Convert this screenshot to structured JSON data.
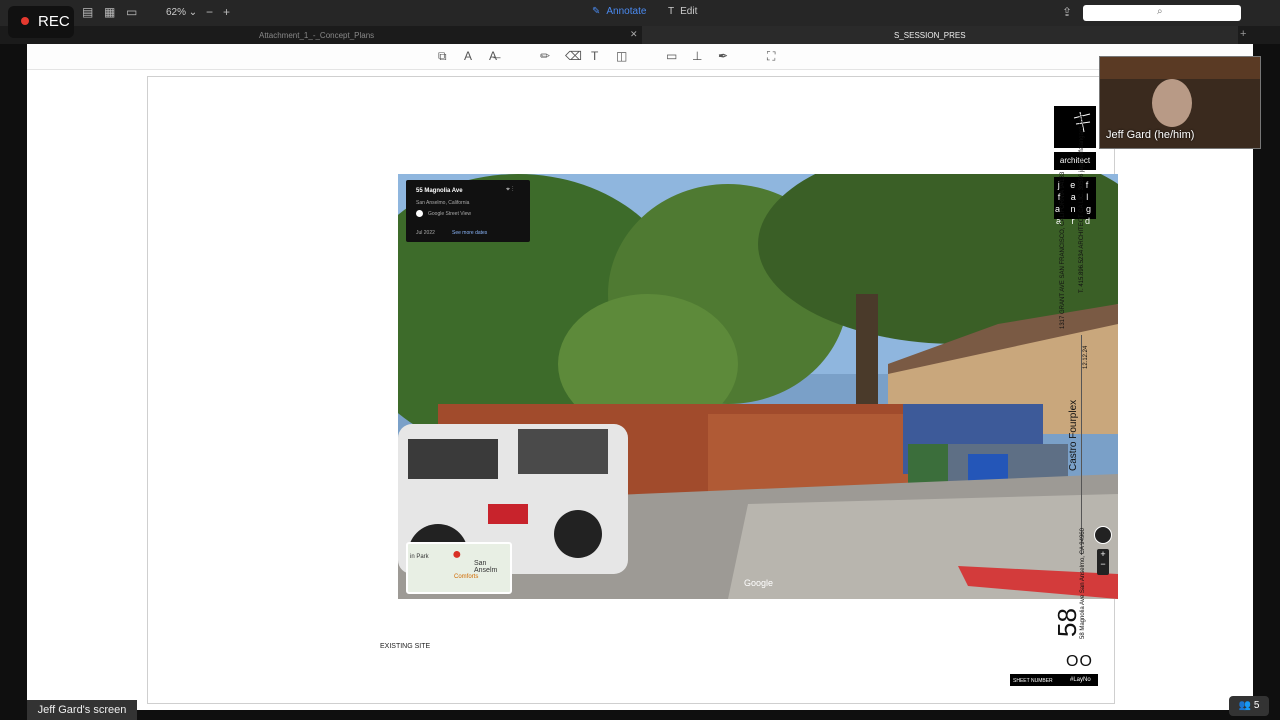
{
  "recording": {
    "label": "REC"
  },
  "toolbar": {
    "zoom": "62%",
    "annotate_label": "Annotate",
    "edit_label": "Edit"
  },
  "tabs": [
    {
      "label": "Attachment_1_-_Concept_Plans"
    },
    {
      "label": "S_SESSION_PRES"
    }
  ],
  "streetview": {
    "address": "55 Magnolia Ave",
    "city": "San Anselmo, California",
    "source": "Google Street View",
    "date": "Jul 2022",
    "more_dates": "See more dates",
    "map_town": "San Anselm",
    "map_place": "Comforts",
    "map_park": "in Park",
    "logo": "Google"
  },
  "sheet": {
    "caption": "EXISTING SITE",
    "architect_tag": "architect",
    "firm_letters": "j e f f a l a n g a r d",
    "address_line": "1317 GRANT AVE SAN FRANCISCO, CALIFORNIA 94133",
    "contact_line": "T. 415.896.5234 ARCHITECT CA LIC. 30596 jag@jeffalangard.com",
    "date": "12.12.24",
    "project": "Castro Fourplex",
    "project_address": "58 Magnolia Ave San Anselmo, CA 94960",
    "sheet_big": "58",
    "sheet_oo": "OO",
    "sheet_number_label": "SHEET NUMBER",
    "sheet_tag": "#LayNo"
  },
  "video": {
    "participant_name": "Jeff Gard (he/him)"
  },
  "screen_share": {
    "label": "Jeff Gard's screen"
  },
  "participants": {
    "count": "5"
  },
  "colors": {
    "accent": "#4a8af0",
    "rec": "#e5392f"
  }
}
